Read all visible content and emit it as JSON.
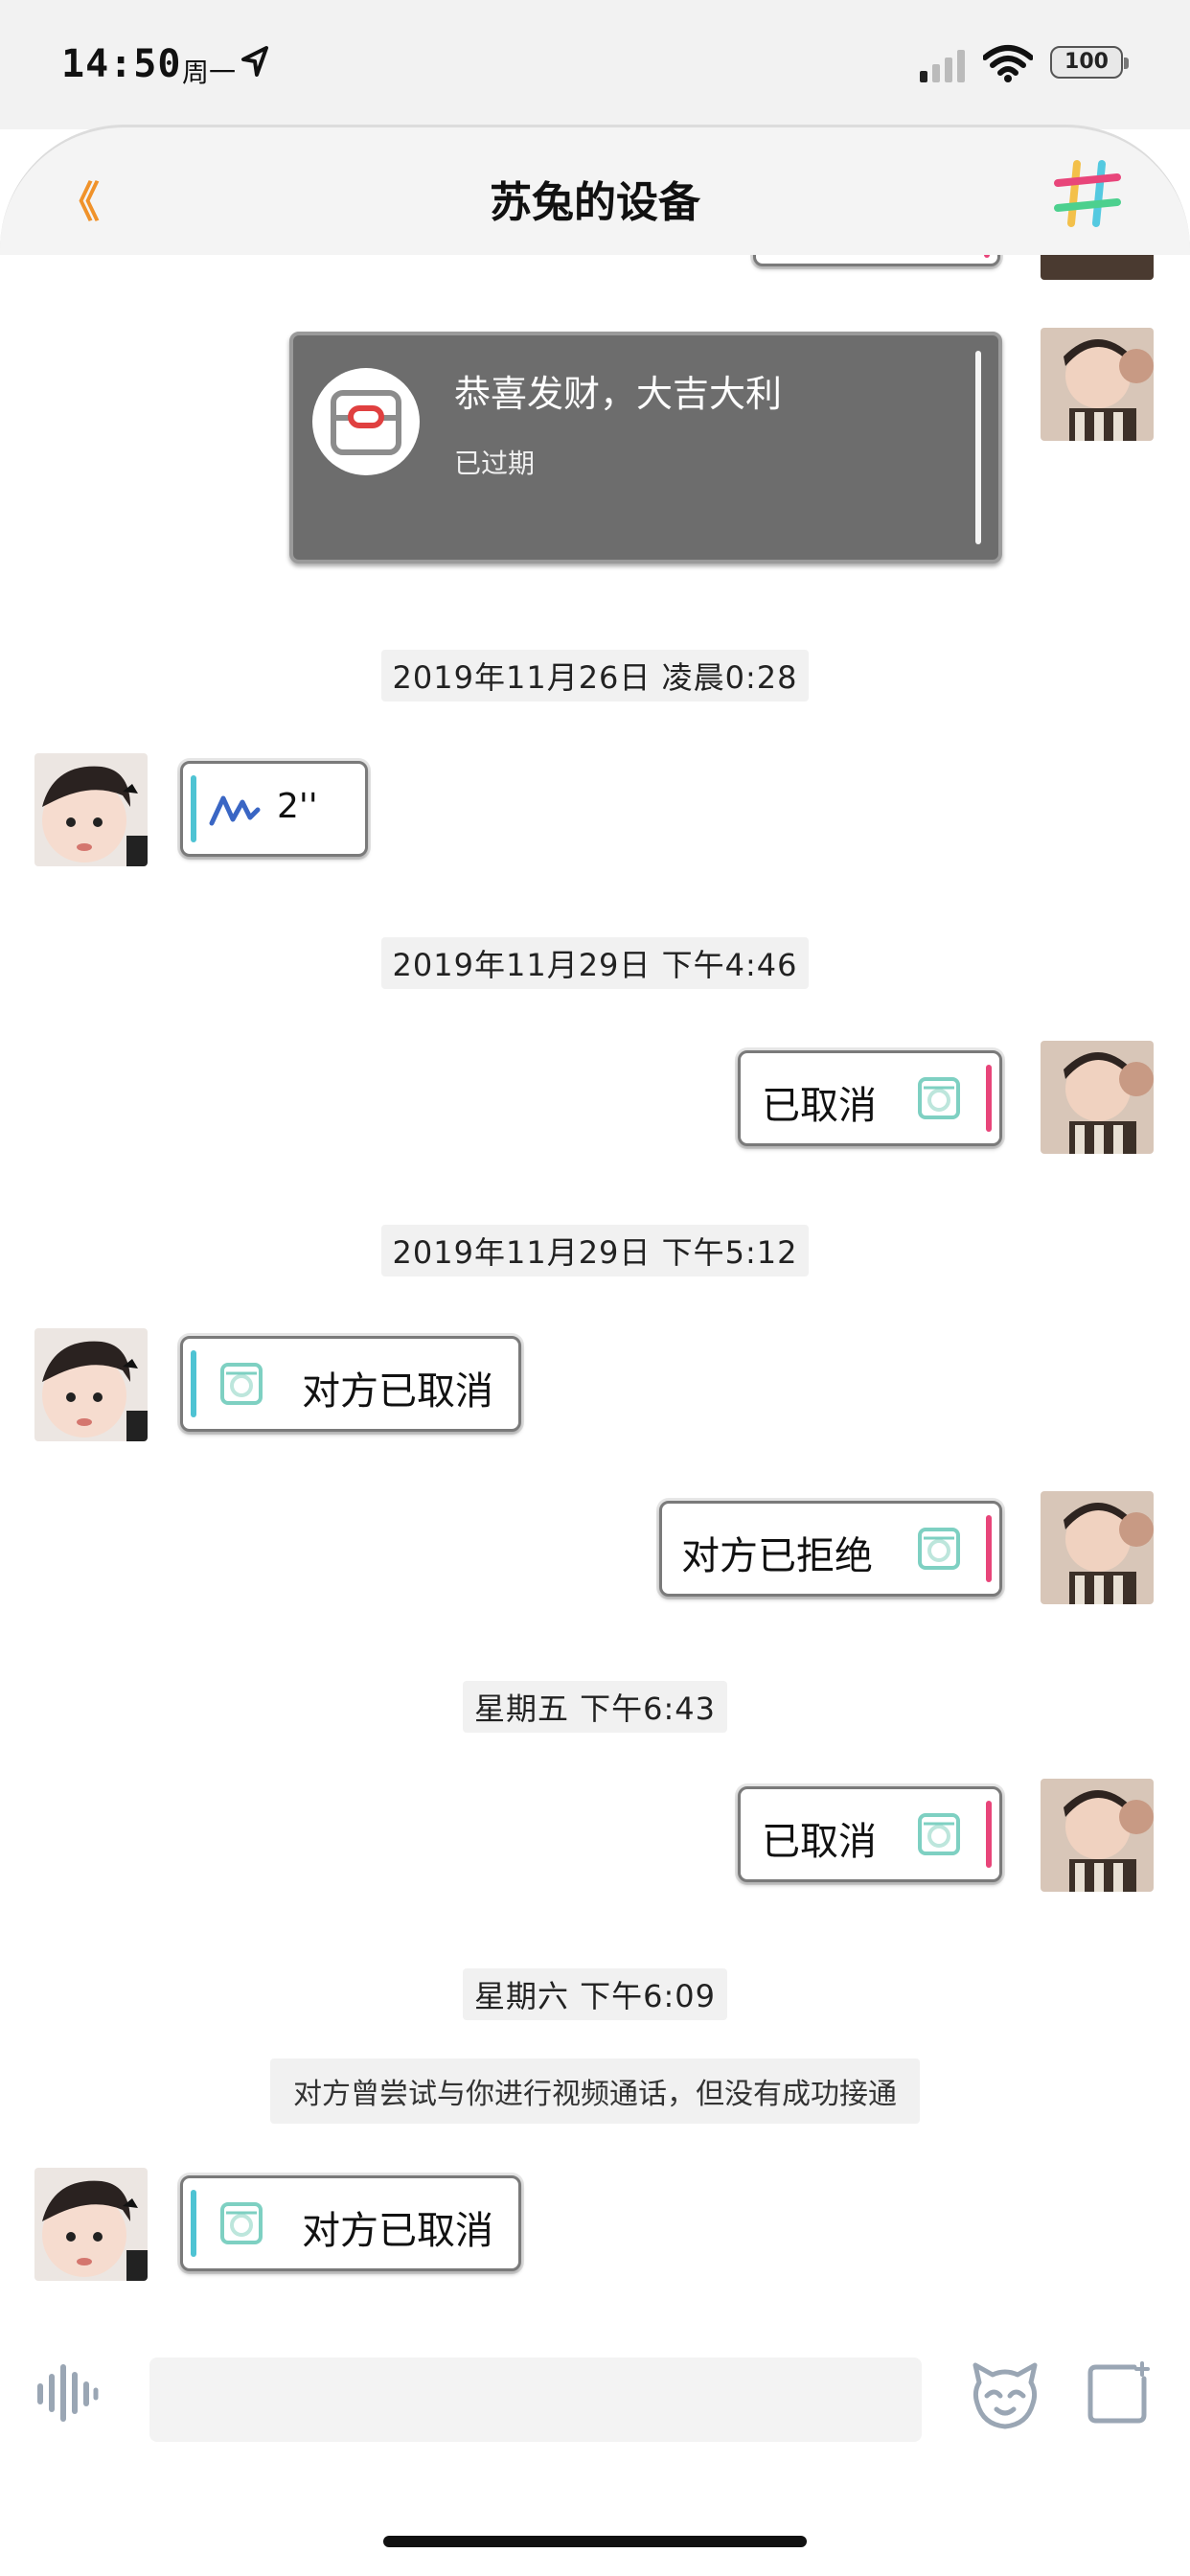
{
  "status_bar": {
    "time": "14:50",
    "day": "周一",
    "battery": "100"
  },
  "header": {
    "back_label": "《",
    "title": "苏兔的设备",
    "menu_icon": "hashtag-icon"
  },
  "colors": {
    "accent_back": "#f0922a",
    "incoming_bar": "#4ec3d3",
    "outgoing_bar": "#e8457a",
    "red_packet_bg": "#6d6d6d"
  },
  "messages": {
    "red_packet": {
      "title": "恭喜发财，大吉大利",
      "status": "已过期"
    },
    "ts1": "2019年11月26日 凌晨0:28",
    "voice": {
      "duration": "2''"
    },
    "ts2": "2019年11月29日 下午4:46",
    "call1": "已取消",
    "ts3": "2019年11月29日 下午5:12",
    "call2": "对方已取消",
    "call3": "对方已拒绝",
    "ts4": "星期五 下午6:43",
    "call4": "已取消",
    "ts5": "星期六 下午6:09",
    "system_note": "对方曾尝试与你进行视频通话，但没有成功接通",
    "call5": "对方已取消"
  },
  "input": {
    "placeholder": ""
  }
}
